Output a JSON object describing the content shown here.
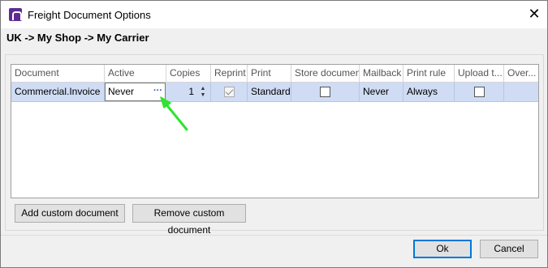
{
  "window": {
    "title": "Freight Document Options",
    "close_glyph": "✕"
  },
  "breadcrumb": "UK -> My Shop -> My Carrier",
  "grid": {
    "columns": [
      "Document",
      "Active",
      "Copies",
      "Reprint",
      "Print",
      "Store document",
      "Mailback",
      "Print rule",
      "Upload t...",
      "Over..."
    ],
    "row": {
      "document": "Commercial.Invoice",
      "active": "Never",
      "active_button": "···",
      "copies": "1",
      "reprint_checked": true,
      "print": "Standard",
      "store_document_checked": false,
      "mailback": "Never",
      "print_rule": "Always",
      "upload_checked": false
    }
  },
  "buttons": {
    "add_custom": "Add custom document",
    "remove_custom": "Remove custom document",
    "ok": "Ok",
    "cancel": "Cancel"
  },
  "colors": {
    "selection": "#cfdcf4",
    "arrow": "#2ee42e",
    "default_button_border": "#0078d7",
    "app_icon": "#5c2d91"
  },
  "icons": {
    "app": "app-logo-icon",
    "close": "close-icon",
    "ellipsis": "ellipsis-icon",
    "spin_up": "chevron-up-icon",
    "spin_down": "chevron-down-icon",
    "annotation": "arrow-annotation-icon"
  }
}
